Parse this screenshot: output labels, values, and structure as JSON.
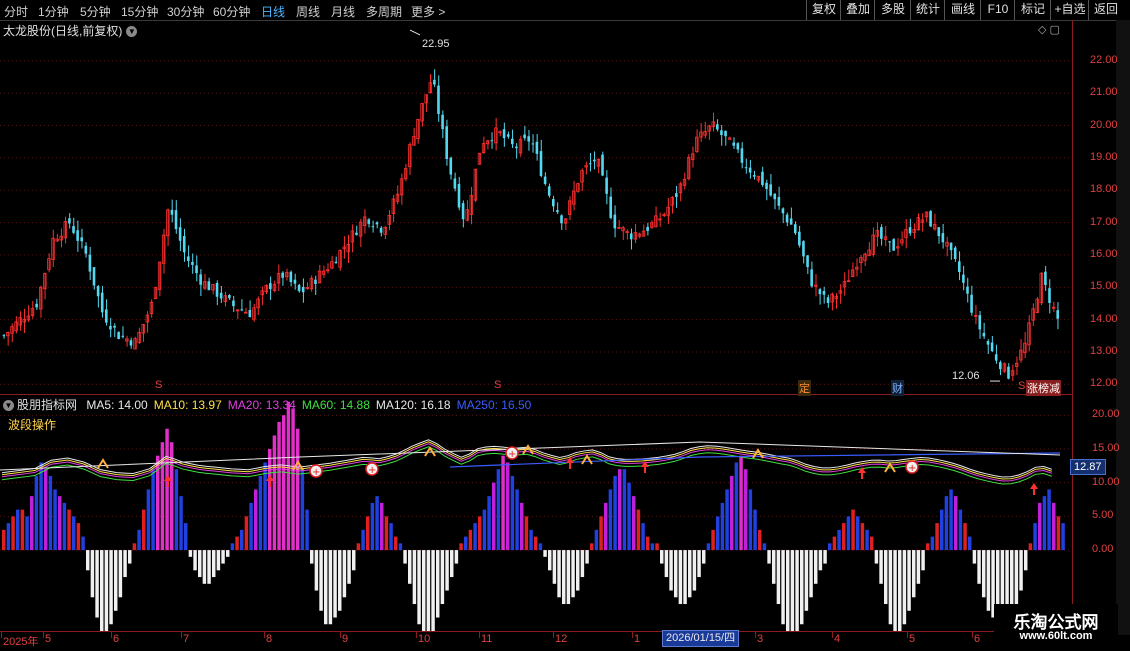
{
  "toolbar": {
    "timeframes": [
      "分时",
      "1分钟",
      "5分钟",
      "15分钟",
      "30分钟",
      "60分钟",
      "日线",
      "周线",
      "月线",
      "多周期",
      "更多 >"
    ],
    "active_timeframe": "日线",
    "buttons": [
      "复权",
      "叠加",
      "多股",
      "统计",
      "画线",
      "F10",
      "标记",
      "+自选",
      "返回"
    ]
  },
  "main_title": "太龙股份(日线,前复权)",
  "indicator": {
    "name": "股朋指标网",
    "subtitle": "波段操作",
    "ma_entries": [
      {
        "label": "MA5:",
        "value": "14.00",
        "color": "#e8e8e8"
      },
      {
        "label": "MA10:",
        "value": "13.97",
        "color": "#ffe04a"
      },
      {
        "label": "MA20:",
        "value": "13.34",
        "color": "#e040e0"
      },
      {
        "label": "MA60:",
        "value": "14.88",
        "color": "#40e040"
      },
      {
        "label": "MA120:",
        "value": "16.18",
        "color": "#e8e8e8"
      },
      {
        "label": "MA250:",
        "value": "16.50",
        "color": "#3a5cff"
      }
    ]
  },
  "labels": {
    "high": "22.95",
    "low": "12.06",
    "current": "12.87",
    "date_cursor": "2026/01/15/四",
    "event_ding": "定",
    "event_cai": "财",
    "event_zhang": "涨榜减",
    "event_s": "S"
  },
  "watermark": {
    "line1": "乐淘公式网",
    "line2": "www.60lt.com"
  },
  "chart_data": [
    {
      "type": "candlestick",
      "title": "太龙股份(日线,前复权)",
      "y_ticks": [
        "22.00",
        "21.00",
        "20.00",
        "19.00",
        "18.00",
        "17.00",
        "16.00",
        "15.00",
        "14.00",
        "13.00",
        "12.00"
      ],
      "ylim": [
        11.7,
        23.2
      ],
      "x_ticks": [
        "2025年",
        "5",
        "6",
        "7",
        "8",
        "9",
        "10",
        "11",
        "12",
        "1",
        "2026/01/15/四",
        "3",
        "4",
        "5",
        "6"
      ],
      "high": 22.95,
      "low": 12.06,
      "close_path": [
        13.5,
        14.0,
        14.5,
        16.5,
        17.0,
        16.0,
        14.2,
        13.5,
        13.3,
        14.5,
        17.5,
        16.0,
        15.2,
        14.8,
        14.4,
        14.2,
        15.0,
        15.4,
        14.8,
        15.3,
        15.8,
        16.5,
        17.2,
        16.8,
        18.0,
        20.0,
        21.5,
        18.8,
        17.0,
        19.5,
        19.8,
        19.3,
        19.6,
        18.0,
        17.0,
        18.5,
        19.0,
        17.0,
        16.6,
        16.8,
        17.2,
        18.0,
        19.5,
        20.0,
        19.5,
        18.8,
        18.3,
        17.5,
        16.8,
        15.2,
        14.5,
        15.0,
        16.0,
        16.6,
        16.2,
        16.8,
        17.2,
        16.5,
        15.5,
        14.0,
        13.0,
        12.3,
        13.2,
        15.3,
        14.0
      ]
    },
    {
      "type": "bar",
      "title": "波段操作",
      "y_ticks": [
        "20.00",
        "15.00",
        "10.00",
        "5.00",
        "0.00"
      ],
      "ylim": [
        -12,
        23
      ],
      "values": [
        3,
        4,
        5,
        6,
        6,
        5,
        8,
        11,
        13,
        12,
        11,
        9,
        8,
        7,
        6,
        5,
        4,
        2,
        -3,
        -7,
        -10,
        -12,
        -12,
        -11,
        -9,
        -7,
        -4,
        -2,
        1,
        3,
        6,
        9,
        12,
        14,
        16,
        18,
        16,
        12,
        8,
        4,
        -1,
        -3,
        -4,
        -5,
        -5,
        -4,
        -3,
        -2,
        -1,
        1,
        2,
        3,
        5,
        7,
        9,
        11,
        13,
        15,
        17,
        19,
        20,
        22,
        21,
        18,
        12,
        6,
        -2,
        -6,
        -9,
        -11,
        -11,
        -10,
        -9,
        -7,
        -5,
        -3,
        1,
        3,
        5,
        7,
        8,
        7,
        5,
        4,
        2,
        1,
        -2,
        -5,
        -8,
        -11,
        -13,
        -14,
        -12,
        -10,
        -8,
        -6,
        -4,
        -2,
        1,
        2,
        3,
        4,
        5,
        6,
        8,
        10,
        12,
        14,
        13,
        11,
        9,
        7,
        5,
        3,
        2,
        1,
        -1,
        -3,
        -5,
        -7,
        -8,
        -8,
        -7,
        -6,
        -4,
        -2,
        1,
        3,
        5,
        7,
        9,
        11,
        12,
        12,
        10,
        8,
        6,
        4,
        2,
        1,
        1,
        -2,
        -4,
        -6,
        -7,
        -8,
        -8,
        -7,
        -6,
        -4,
        -2,
        1,
        3,
        5,
        7,
        9,
        11,
        13,
        14,
        12,
        9,
        6,
        3,
        1,
        -2,
        -5,
        -8,
        -11,
        -13,
        -14,
        -13,
        -11,
        -9,
        -7,
        -5,
        -3,
        -2,
        1,
        2,
        3,
        4,
        5,
        6,
        5,
        4,
        3,
        2,
        -2,
        -5,
        -8,
        -11,
        -12,
        -12,
        -11,
        -9,
        -7,
        -5,
        -3,
        1,
        2,
        4,
        6,
        8,
        9,
        8,
        6,
        4,
        2,
        -2,
        -5,
        -7,
        -9,
        -10,
        -11,
        -12,
        -12,
        -11,
        -9,
        -6,
        -3,
        1,
        4,
        7,
        8,
        9,
        7,
        5,
        4
      ]
    }
  ]
}
